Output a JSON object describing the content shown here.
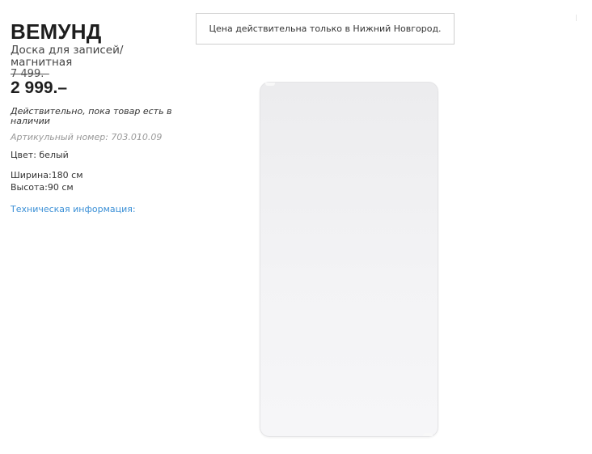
{
  "product": {
    "name": "ВЕМУНД",
    "description": "Доска для записей/ магнитная",
    "old_price": "7 499.–",
    "price": "2 999.–",
    "validity": "Действительно, пока товар есть в наличии",
    "article": "Артикульный номер: 703.010.09",
    "color": "Цвет: белый",
    "width": "Ширина:180 см",
    "height": "Высота:90 см",
    "tech_info_link": "Техническая информация:"
  },
  "notice": {
    "text": "Цена действительна только в Нижний Новгород."
  },
  "image": {
    "icon": "whiteboard-product-image",
    "colors": {
      "surface": "#f0f0f2",
      "border": "#e4e4e6"
    }
  },
  "colors": {
    "link": "#3a8fd6",
    "name": "#1e1e1e"
  }
}
